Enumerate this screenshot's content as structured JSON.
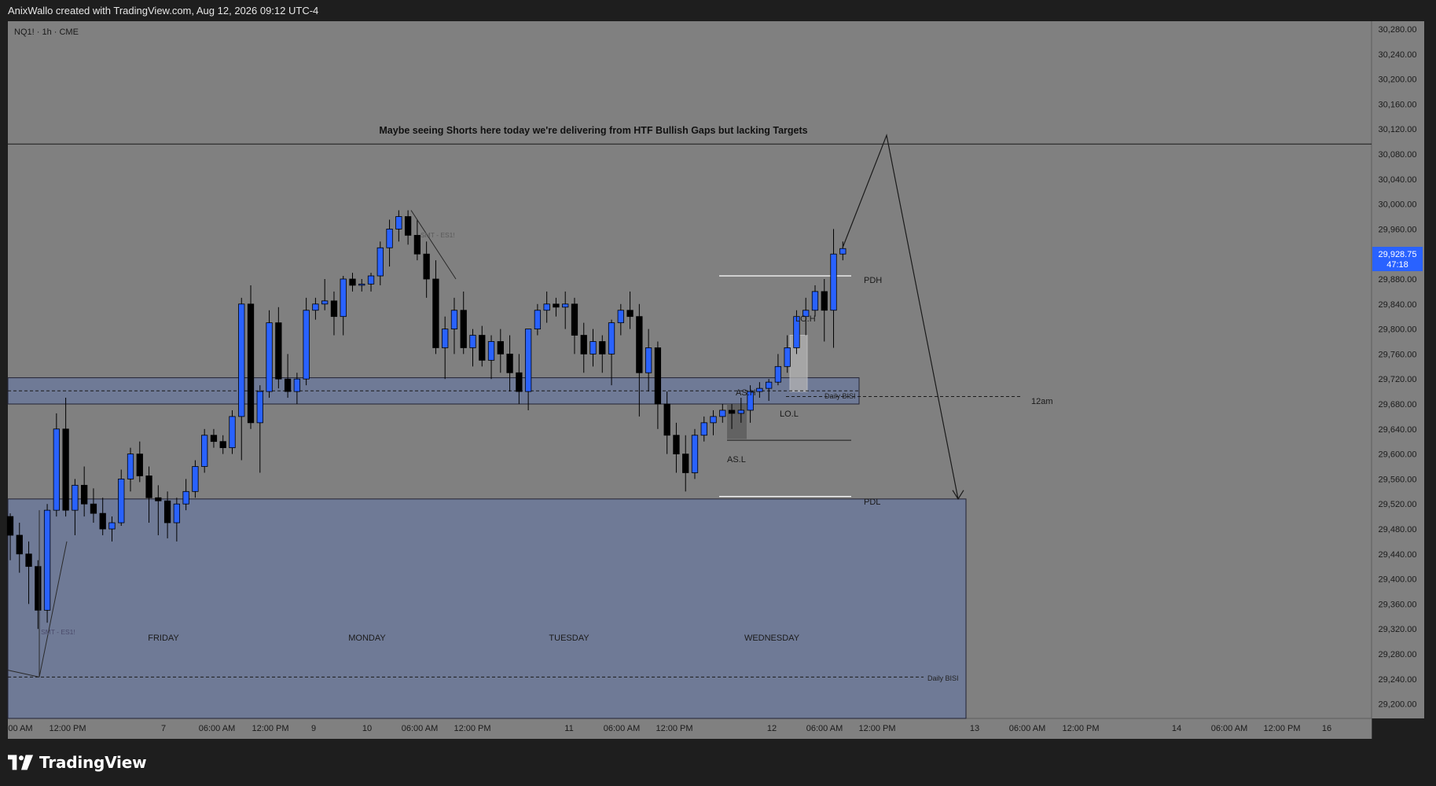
{
  "header": {
    "attribution": "AnixWallo created with TradingView.com, Aug 12, 2026 09:12 UTC-4"
  },
  "brand": {
    "name": "TradingView"
  },
  "colors": {
    "background": "#1e1e1e",
    "plot_area": "#808080",
    "bull_candle": "#2962ff",
    "bear_candle": "#000000",
    "zone_fill": "#6f7a96",
    "last_price_tag": "#2962ff"
  },
  "chart_data": {
    "type": "candlestick",
    "symbol_label": "NQ1! · 1h · CME",
    "annotation": "Maybe seeing Shorts here today we're delivering from HTF Bullish Gaps but lacking Targets",
    "y_axis": {
      "ticks": [
        30280,
        30240,
        30200,
        30160,
        30120,
        30080,
        30040,
        30000,
        29960,
        29920,
        29880,
        29840,
        29800,
        29760,
        29720,
        29680,
        29640,
        29600,
        29560,
        29520,
        29480,
        29440,
        29400,
        29360,
        29320,
        29280,
        29240,
        29200
      ],
      "ylim": [
        29190,
        30295
      ]
    },
    "last_price": {
      "value": "29,928.75",
      "countdown": "47:18"
    },
    "x_axis_ticks": [
      "00 AM",
      "12:00 PM",
      "7",
      "06:00 AM",
      "12:00 PM",
      "9",
      "10",
      "06:00 AM",
      "12:00 PM",
      "11",
      "06:00 AM",
      "12:00 PM",
      "12",
      "06:00 AM",
      "12:00 PM",
      "13",
      "06:00 AM",
      "12:00 PM",
      "14",
      "06:00 AM",
      "12:00 PM",
      "16"
    ],
    "day_labels": [
      "FRIDAY",
      "MONDAY",
      "TUESDAY",
      "WEDNESDAY"
    ],
    "candles": [
      [
        29500,
        29505,
        29430,
        29470
      ],
      [
        29470,
        29490,
        29410,
        29440
      ],
      [
        29440,
        29460,
        29360,
        29420
      ],
      [
        29420,
        29430,
        29320,
        29350
      ],
      [
        29350,
        29520,
        29330,
        29510
      ],
      [
        29510,
        29665,
        29500,
        29640
      ],
      [
        29640,
        29690,
        29500,
        29510
      ],
      [
        29510,
        29560,
        29470,
        29550
      ],
      [
        29550,
        29580,
        29500,
        29520
      ],
      [
        29520,
        29545,
        29490,
        29505
      ],
      [
        29505,
        29530,
        29470,
        29480
      ],
      [
        29480,
        29500,
        29460,
        29490
      ],
      [
        29490,
        29575,
        29485,
        29560
      ],
      [
        29560,
        29610,
        29540,
        29600
      ],
      [
        29600,
        29620,
        29555,
        29565
      ],
      [
        29565,
        29580,
        29490,
        29530
      ],
      [
        29530,
        29550,
        29470,
        29525
      ],
      [
        29525,
        29540,
        29465,
        29490
      ],
      [
        29490,
        29530,
        29460,
        29520
      ],
      [
        29520,
        29560,
        29510,
        29540
      ],
      [
        29540,
        29590,
        29530,
        29580
      ],
      [
        29580,
        29640,
        29570,
        29630
      ],
      [
        29630,
        29640,
        29610,
        29620
      ],
      [
        29620,
        29630,
        29600,
        29610
      ],
      [
        29610,
        29670,
        29600,
        29660
      ],
      [
        29660,
        29850,
        29590,
        29840
      ],
      [
        29840,
        29870,
        29640,
        29650
      ],
      [
        29650,
        29710,
        29570,
        29700
      ],
      [
        29700,
        29830,
        29690,
        29810
      ],
      [
        29810,
        29835,
        29705,
        29720
      ],
      [
        29720,
        29760,
        29690,
        29700
      ],
      [
        29700,
        29730,
        29680,
        29720
      ],
      [
        29720,
        29850,
        29710,
        29830
      ],
      [
        29830,
        29850,
        29815,
        29840
      ],
      [
        29840,
        29880,
        29830,
        29845
      ],
      [
        29845,
        29860,
        29790,
        29820
      ],
      [
        29820,
        29885,
        29790,
        29880
      ],
      [
        29880,
        29890,
        29860,
        29870
      ],
      [
        29870,
        29880,
        29860,
        29872
      ],
      [
        29872,
        29890,
        29860,
        29885
      ],
      [
        29885,
        29940,
        29870,
        29930
      ],
      [
        29930,
        29975,
        29900,
        29960
      ],
      [
        29960,
        29990,
        29940,
        29980
      ],
      [
        29980,
        29990,
        29935,
        29950
      ],
      [
        29950,
        29975,
        29910,
        29920
      ],
      [
        29920,
        29940,
        29850,
        29880
      ],
      [
        29880,
        29910,
        29760,
        29770
      ],
      [
        29770,
        29820,
        29720,
        29800
      ],
      [
        29800,
        29850,
        29760,
        29830
      ],
      [
        29830,
        29860,
        29760,
        29770
      ],
      [
        29770,
        29800,
        29740,
        29790
      ],
      [
        29790,
        29805,
        29740,
        29750
      ],
      [
        29750,
        29790,
        29720,
        29780
      ],
      [
        29780,
        29800,
        29730,
        29760
      ],
      [
        29760,
        29790,
        29700,
        29730
      ],
      [
        29730,
        29760,
        29680,
        29700
      ],
      [
        29700,
        29800,
        29670,
        29800
      ],
      [
        29800,
        29840,
        29790,
        29830
      ],
      [
        29830,
        29860,
        29810,
        29840
      ],
      [
        29840,
        29850,
        29820,
        29835
      ],
      [
        29835,
        29860,
        29800,
        29840
      ],
      [
        29840,
        29850,
        29760,
        29790
      ],
      [
        29790,
        29810,
        29730,
        29760
      ],
      [
        29760,
        29800,
        29740,
        29780
      ],
      [
        29780,
        29790,
        29730,
        29760
      ],
      [
        29760,
        29815,
        29710,
        29810
      ],
      [
        29810,
        29840,
        29790,
        29830
      ],
      [
        29830,
        29860,
        29800,
        29820
      ],
      [
        29820,
        29840,
        29660,
        29730
      ],
      [
        29730,
        29800,
        29700,
        29770
      ],
      [
        29770,
        29780,
        29640,
        29680
      ],
      [
        29680,
        29700,
        29600,
        29630
      ],
      [
        29630,
        29650,
        29570,
        29600
      ],
      [
        29600,
        29630,
        29540,
        29570
      ],
      [
        29570,
        29640,
        29560,
        29630
      ],
      [
        29630,
        29660,
        29620,
        29650
      ],
      [
        29650,
        29670,
        29630,
        29660
      ],
      [
        29660,
        29680,
        29650,
        29670
      ],
      [
        29670,
        29680,
        29640,
        29665
      ],
      [
        29665,
        29690,
        29650,
        29670
      ],
      [
        29670,
        29710,
        29650,
        29700
      ],
      [
        29700,
        29715,
        29690,
        29705
      ],
      [
        29705,
        29720,
        29685,
        29715
      ],
      [
        29715,
        29760,
        29710,
        29740
      ],
      [
        29740,
        29790,
        29730,
        29770
      ],
      [
        29770,
        29830,
        29760,
        29820
      ],
      [
        29820,
        29850,
        29790,
        29830
      ],
      [
        29830,
        29870,
        29820,
        29860
      ],
      [
        29860,
        29880,
        29780,
        29830
      ],
      [
        29830,
        29960,
        29770,
        29920
      ],
      [
        29920,
        29940,
        29910,
        29928.75
      ]
    ]
  },
  "labels": {
    "pdh": "PDH",
    "pdl": "PDL",
    "lo_h": "LO.H",
    "lo_l": "LO.L",
    "as_h": "AS.H",
    "as_l": "AS.L",
    "twelve_am": "12am",
    "daily_bisi_1": "Daily BISI",
    "daily_bisi_2": "Daily BISI",
    "smt_top": "SMT - ES1!",
    "smt_bottom": "SMT - ES1!"
  }
}
